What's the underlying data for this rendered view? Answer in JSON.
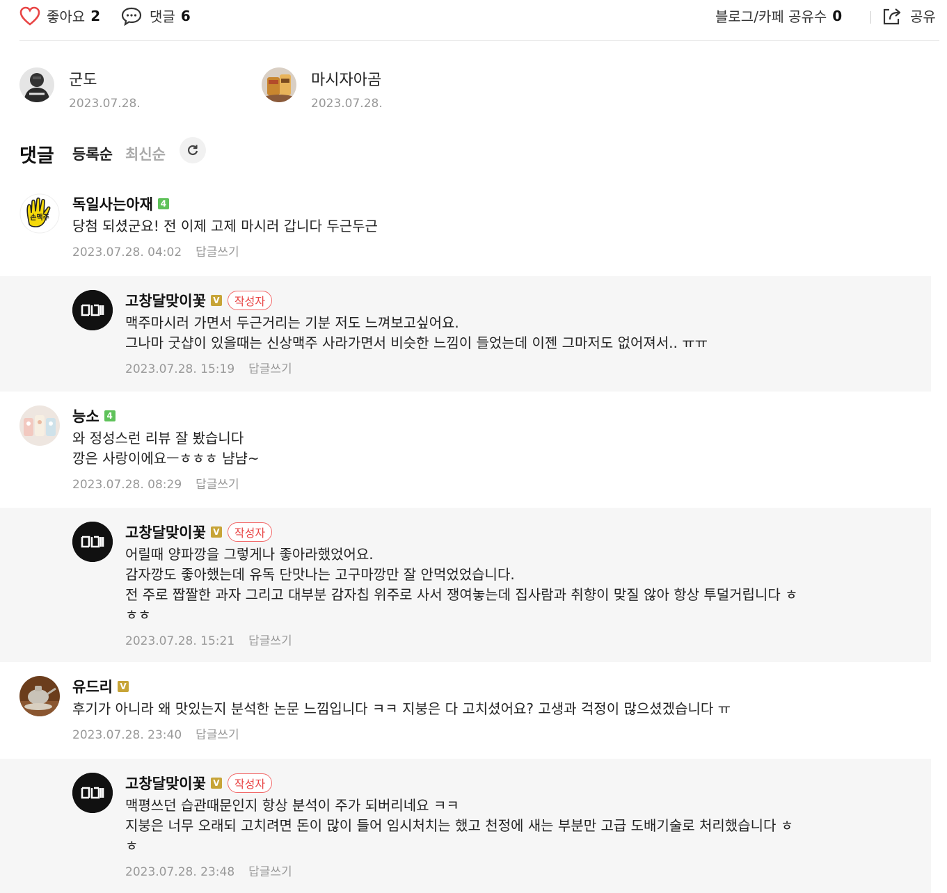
{
  "topbar": {
    "like_label": "좋아요",
    "like_count": "2",
    "comment_label": "댓글",
    "comment_count": "6",
    "share_count_label": "블로그/카페 공유수",
    "share_count": "0",
    "share_label": "공유",
    "icons": [
      "heart-icon",
      "speech-bubble-icon",
      "share-icon"
    ],
    "accent": "#e84545"
  },
  "likers": [
    {
      "name": "군도",
      "date": "2023.07.28."
    },
    {
      "name": "마시자아곰",
      "date": "2023.07.28."
    }
  ],
  "comments_header": {
    "title": "댓글",
    "sort_registered": "등록순",
    "sort_latest": "최신순",
    "refresh_icon": "refresh-icon"
  },
  "comments": [
    {
      "name": "독일사는아재",
      "badge": "4",
      "text": "당첨 되셨군요! 전 이제 고제 마시러 갑니다 두근두근",
      "time": "2023.07.28. 04:02",
      "reply": "답글쓰기"
    },
    {
      "name": "고창달맞이꽃",
      "badge": "V",
      "author_tag": "작성자",
      "text": "맥주마시러 가면서 두근거리는 기분 저도 느껴보고싶어요.\n그나마 굿샵이 있을때는 신상맥주 사라가면서 비슷한 느낌이 들었는데 이젠 그마저도 없어져서.. ㅠㅠ",
      "time": "2023.07.28. 15:19",
      "reply": "답글쓰기"
    },
    {
      "name": "능소",
      "badge": "4",
      "text": "와 정성스런 리뷰 잘 봤습니다\n깡은 사랑이에요ㅡㅎㅎㅎ 냠냠~",
      "time": "2023.07.28. 08:29",
      "reply": "답글쓰기"
    },
    {
      "name": "고창달맞이꽃",
      "badge": "V",
      "author_tag": "작성자",
      "text": "어릴때 양파깡을 그렇게나 좋아라했었어요.\n감자깡도 좋아했는데 유독 단맛나는 고구마깡만 잘 안먹었었습니다.\n전 주로 짭짤한 과자 그리고 대부분 감자칩 위주로 사서 쟁여놓는데 집사람과 취향이 맞질 않아 항상 투덜거립니다 ㅎ\nㅎㅎ",
      "time": "2023.07.28. 15:21",
      "reply": "답글쓰기"
    },
    {
      "name": "유드리",
      "badge": "V",
      "text": "후기가 아니라 왜 맛있는지 분석한 논문 느낌입니다 ㅋㅋ 지붕은 다 고치셨어요? 고생과 걱정이 많으셨겠습니다 ㅠ",
      "time": "2023.07.28. 23:40",
      "reply": "답글쓰기"
    },
    {
      "name": "고창달맞이꽃",
      "badge": "V",
      "author_tag": "작성자",
      "text": "맥평쓰던 습관때문인지 항상 분석이 주가 되버리네요 ㅋㅋ\n지붕은 너무 오래되 고치려면 돈이 많이 들어 임시처치는 했고 천정에 새는 부분만 고급 도배기술로 처리했습니다 ㅎ\nㅎ",
      "time": "2023.07.28. 23:48",
      "reply": "답글쓰기"
    }
  ]
}
